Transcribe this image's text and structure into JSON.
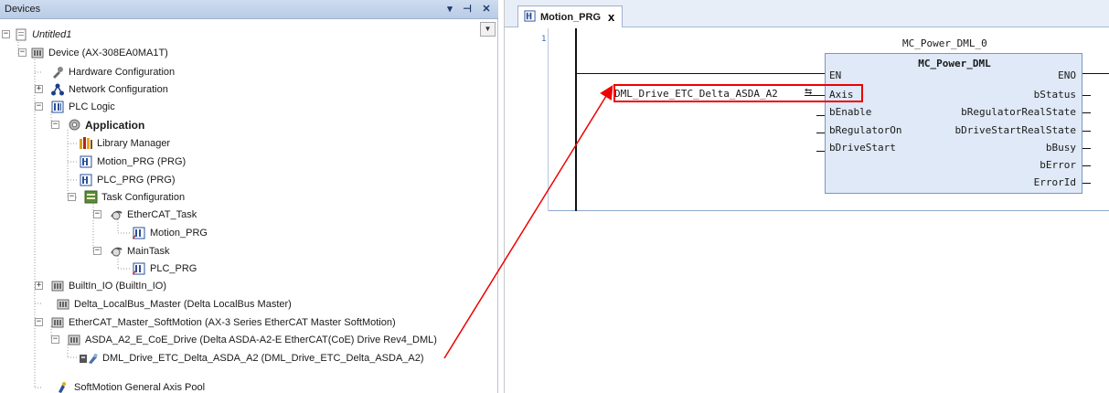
{
  "devices_panel": {
    "title": "Devices",
    "pin_icon": "pin-icon",
    "close_icon": "close-icon",
    "menu_icon": "dropdown-arrow-icon",
    "tree": [
      {
        "label": "Untitled1",
        "icon": "project-icon",
        "expander": "−"
      },
      {
        "label": "Device (AX-308EA0MA1T)",
        "icon": "device-icon",
        "expander": "−"
      },
      {
        "label": "Hardware Configuration",
        "icon": "hardware-config-icon",
        "expander": ""
      },
      {
        "label": "Network Configuration",
        "icon": "network-config-icon",
        "expander": "+"
      },
      {
        "label": "PLC Logic",
        "icon": "plc-logic-icon",
        "expander": "−"
      },
      {
        "label": "Application",
        "icon": "application-gear-icon",
        "expander": "−"
      },
      {
        "label": "Library Manager",
        "icon": "library-manager-icon",
        "expander": ""
      },
      {
        "label": "Motion_PRG (PRG)",
        "icon": "program-icon",
        "expander": ""
      },
      {
        "label": "PLC_PRG (PRG)",
        "icon": "program-icon",
        "expander": ""
      },
      {
        "label": "Task Configuration",
        "icon": "task-config-icon",
        "expander": "−"
      },
      {
        "label": "EtherCAT_Task",
        "icon": "task-icon",
        "expander": "−"
      },
      {
        "label": "Motion_PRG",
        "icon": "program-call-icon",
        "expander": ""
      },
      {
        "label": "MainTask",
        "icon": "task-icon",
        "expander": "−"
      },
      {
        "label": "PLC_PRG",
        "icon": "program-call-icon",
        "expander": ""
      },
      {
        "label": "BuiltIn_IO (BuiltIn_IO)",
        "icon": "module-icon",
        "expander": "+"
      },
      {
        "label": "Delta_LocalBus_Master (Delta LocalBus Master)",
        "icon": "module-icon",
        "expander": ""
      },
      {
        "label": "EtherCAT_Master_SoftMotion (AX-3 Series EtherCAT Master SoftMotion)",
        "icon": "module-icon",
        "expander": "−"
      },
      {
        "label": "ASDA_A2_E_CoE_Drive (Delta ASDA-A2-E EtherCAT(CoE) Drive Rev4_DML)",
        "icon": "module-icon",
        "expander": "−"
      },
      {
        "label": "DML_Drive_ETC_Delta_ASDA_A2 (DML_Drive_ETC_Delta_ASDA_A2)",
        "icon": "axis-icon",
        "expander": ""
      },
      {
        "label": "SoftMotion General Axis Pool",
        "icon": "axis-pool-icon",
        "expander": ""
      }
    ]
  },
  "editor": {
    "tab_label": "Motion_PRG",
    "tab_close": "x",
    "line_number": "1",
    "fb_instance_name": "MC_Power_DML_0",
    "fb_type_name": "MC_Power_DML",
    "axis_variable": "DML_Drive_ETC_Delta_ASDA_A2",
    "inputs": [
      "EN",
      "Axis",
      "bEnable",
      "bRegulatorOn",
      "bDriveStart"
    ],
    "outputs": [
      "ENO",
      "bStatus",
      "bRegulatorRealState",
      "bDriveStartRealState",
      "bBusy",
      "bError",
      "ErrorId"
    ]
  },
  "colors": {
    "highlight": "#ee0000",
    "fb_fill": "#dfe9f7",
    "header_fill": "#c3d4ec"
  }
}
